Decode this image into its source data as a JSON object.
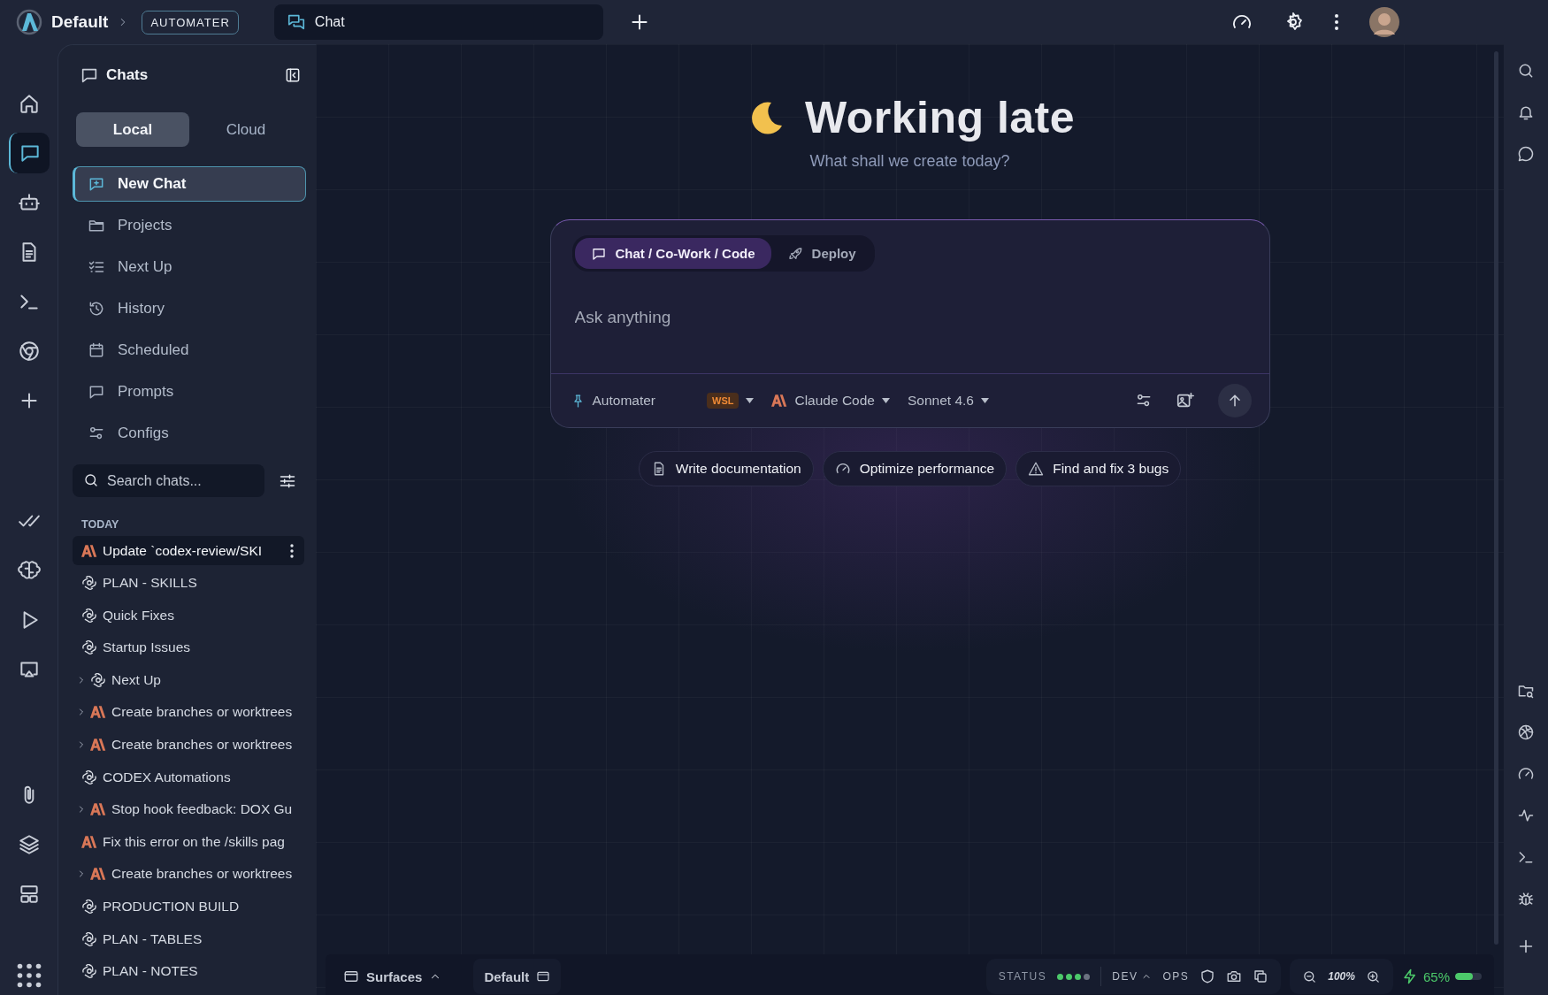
{
  "top_bar": {
    "workspace": "Default",
    "badge": "AUTOMATER",
    "tabs": [
      {
        "label": "Chat",
        "selected": true
      }
    ]
  },
  "left_rail": [
    {
      "selected": false
    },
    {
      "selected": true
    },
    {
      "selected": false
    },
    {
      "selected": false
    },
    {
      "selected": false
    },
    {
      "selected": false
    },
    {
      "selected": false
    },
    {
      "selected": false
    },
    {
      "selected": false
    },
    {
      "selected": false
    },
    {
      "selected": false
    },
    {
      "selected": false
    },
    {
      "selected": false
    },
    {
      "selected": false
    },
    {
      "selected": false
    }
  ],
  "sidebar": {
    "title": "Chats",
    "scope_tabs": [
      {
        "label": "Local",
        "selected": true
      },
      {
        "label": "Cloud",
        "selected": false
      }
    ],
    "nav": [
      {
        "label": "New Chat",
        "selected": true
      },
      {
        "label": "Projects",
        "selected": false
      },
      {
        "label": "Next Up",
        "selected": false
      },
      {
        "label": "History",
        "selected": false
      },
      {
        "label": "Scheduled",
        "selected": false
      },
      {
        "label": "Prompts",
        "selected": false
      },
      {
        "label": "Configs",
        "selected": false
      }
    ],
    "search": {
      "placeholder": "Search chats..."
    },
    "section": "TODAY",
    "chats": [
      {
        "title": "Update `codex-review/SKI",
        "kind": "claude",
        "expandable": false,
        "selected": true
      },
      {
        "title": "PLAN - SKILLS",
        "kind": "openai",
        "expandable": false,
        "selected": false
      },
      {
        "title": "Quick Fixes",
        "kind": "openai",
        "expandable": false,
        "selected": false
      },
      {
        "title": "Startup Issues",
        "kind": "openai",
        "expandable": false,
        "selected": false
      },
      {
        "title": "Next Up",
        "kind": "openai",
        "expandable": true,
        "selected": false
      },
      {
        "title": "Create branches or worktrees",
        "kind": "claude",
        "expandable": true,
        "selected": false
      },
      {
        "title": "Create branches or worktrees",
        "kind": "claude",
        "expandable": true,
        "selected": false
      },
      {
        "title": "CODEX Automations",
        "kind": "openai",
        "expandable": false,
        "selected": false
      },
      {
        "title": "Stop hook feedback: DOX Gu",
        "kind": "claude",
        "expandable": true,
        "selected": false
      },
      {
        "title": "Fix this error on the /skills pag",
        "kind": "claude",
        "expandable": false,
        "selected": false
      },
      {
        "title": "Create branches or worktrees",
        "kind": "claude",
        "expandable": true,
        "selected": false
      },
      {
        "title": "PRODUCTION BUILD",
        "kind": "openai",
        "expandable": false,
        "selected": false
      },
      {
        "title": "PLAN - TABLES",
        "kind": "openai",
        "expandable": false,
        "selected": false
      },
      {
        "title": "PLAN - NOTES",
        "kind": "openai",
        "expandable": false,
        "selected": false
      }
    ]
  },
  "hero": {
    "title": "Working late",
    "subtitle": "What shall we create today?"
  },
  "composer": {
    "modes": [
      {
        "label": "Chat / Co-Work / Code",
        "selected": true
      },
      {
        "label": "Deploy",
        "selected": false
      }
    ],
    "placeholder": "Ask anything",
    "project": "Automater",
    "env": "WSL",
    "agent": "Claude Code",
    "model": "Sonnet 4.6"
  },
  "suggestions": [
    "Write documentation",
    "Optimize performance",
    "Find and fix 3 bugs"
  ],
  "bottom_bar": {
    "surfaces": "Surfaces",
    "layout": "Default",
    "status_label": "STATUS",
    "status_dots": [
      {
        "on": true
      },
      {
        "on": true
      },
      {
        "on": true
      },
      {
        "on": false
      }
    ],
    "dev": "DEV",
    "ops": "OPS",
    "zoom": "100%",
    "battery": {
      "level": 0.65,
      "reading": "65%"
    }
  }
}
